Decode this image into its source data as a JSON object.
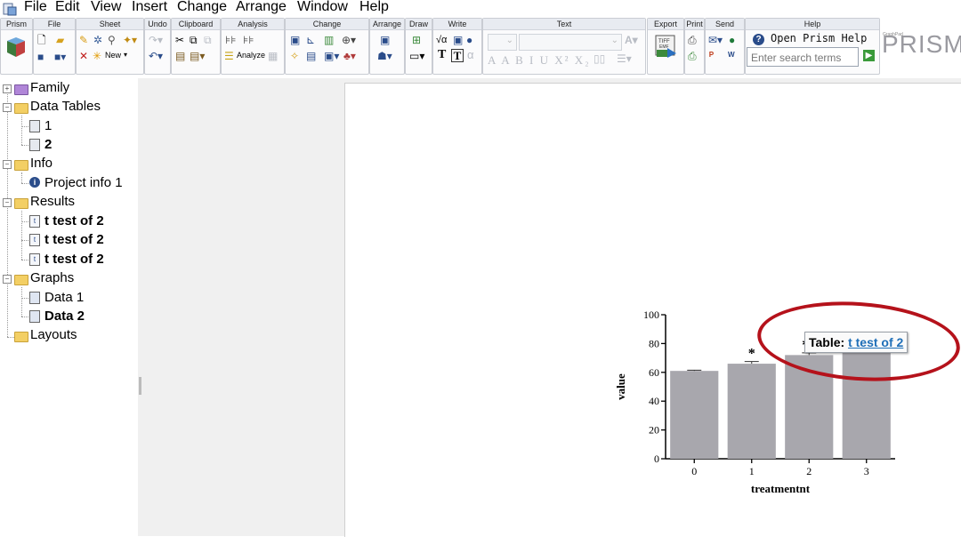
{
  "menubar": {
    "items": [
      "File",
      "Edit",
      "View",
      "Insert",
      "Change",
      "Arrange",
      "Window",
      "Help"
    ]
  },
  "ribbon": {
    "groups": [
      "Prism",
      "File",
      "Sheet",
      "Undo",
      "Clipboard",
      "Analysis",
      "Change",
      "Arrange",
      "Draw",
      "Write",
      "Text",
      "Export",
      "Print",
      "Send",
      "Help"
    ],
    "sheet_new_label": "New",
    "analyze_label": "Analyze",
    "help_link": "Open Prism Help",
    "search_placeholder": "Enter search terms",
    "logo_text": "PRISM",
    "logo_small": "GraphPad",
    "write_glyphs": {
      "sqrt": "√α",
      "t": "T",
      "tbox": "T",
      "alpha": "α"
    },
    "text_glyphs": "A A B I U X² X₂"
  },
  "navigator": {
    "family": "Family",
    "data_tables": "Data Tables",
    "table_1": "1",
    "table_2": "2",
    "info": "Info",
    "project_info": "Project info 1",
    "results": "Results",
    "result_1": "t test of 2",
    "result_2": "t test of 2",
    "result_3": "t test of 2",
    "graphs": "Graphs",
    "graph_1": "Data 1",
    "graph_2": "Data 2",
    "layouts": "Layouts"
  },
  "tooltip": {
    "prefix": "Table:",
    "link": "t test of 2"
  },
  "accent_colors": {
    "bar": "#a8a7ad",
    "highlight_ellipse": "#b5121b",
    "link": "#1f6fb8"
  },
  "chart_data": {
    "type": "bar",
    "categories": [
      "0",
      "1",
      "2",
      "3"
    ],
    "values": [
      61,
      66,
      72,
      74
    ],
    "errors": [
      0.5,
      1.5,
      1.5,
      1.5
    ],
    "significance": [
      "",
      "*",
      "**",
      "***"
    ],
    "xlabel": "treatmentnt",
    "ylabel": "value",
    "ylim": [
      0,
      100
    ],
    "yticks": [
      0,
      20,
      40,
      60,
      80,
      100
    ],
    "grid": false
  }
}
